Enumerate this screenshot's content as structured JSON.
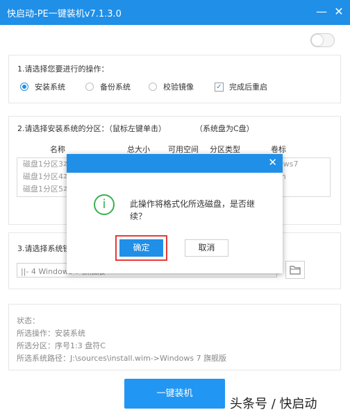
{
  "window": {
    "title": "快启动-PE一键装机v7.1.3.0",
    "minimize_glyph": "—",
    "close_glyph": "✕"
  },
  "operation": {
    "label": "1.请选择您要进行的操作：",
    "options": [
      {
        "label": "安装系统",
        "selected": true
      },
      {
        "label": "备份系统",
        "selected": false
      },
      {
        "label": "校验镜像",
        "selected": false
      }
    ],
    "restart": {
      "label": "完成后重启",
      "checked": true
    }
  },
  "partition": {
    "label": "2.请选择安装系统的分区：（鼠标左键单击）",
    "hint": "（系统盘为C盘）",
    "columns": [
      "名称",
      "总大小",
      "可用空间",
      "分区类型",
      "卷标"
    ],
    "rows": [
      {
        "name": "磁盘1分区3本",
        "volume": "ows7"
      },
      {
        "name": "磁盘1分区4本",
        "volume": "m"
      },
      {
        "name": "磁盘1分区5本",
        "volume": ""
      }
    ]
  },
  "image": {
    "label": "3.请选择系统镜",
    "selected": "||- 4 Windows  7 旗舰版"
  },
  "status": {
    "title": "状态：",
    "operation": "所选操作：安装系统",
    "partition": "所选分区：序号1:3   盘符C",
    "path": "所选系统路径：J:\\sources\\install.wim->Windows  7 旗舰版"
  },
  "install_button": "一键装机",
  "watermark": "头条号 / 快启动",
  "dialog": {
    "close_glyph": "✕",
    "icon_glyph": "i",
    "message": "此操作将格式化所选磁盘，是否继续？",
    "ok": "确定",
    "cancel": "取消"
  },
  "colors": {
    "accent": "#1f8fe8",
    "success": "#37b24d",
    "highlight": "#e53935"
  }
}
